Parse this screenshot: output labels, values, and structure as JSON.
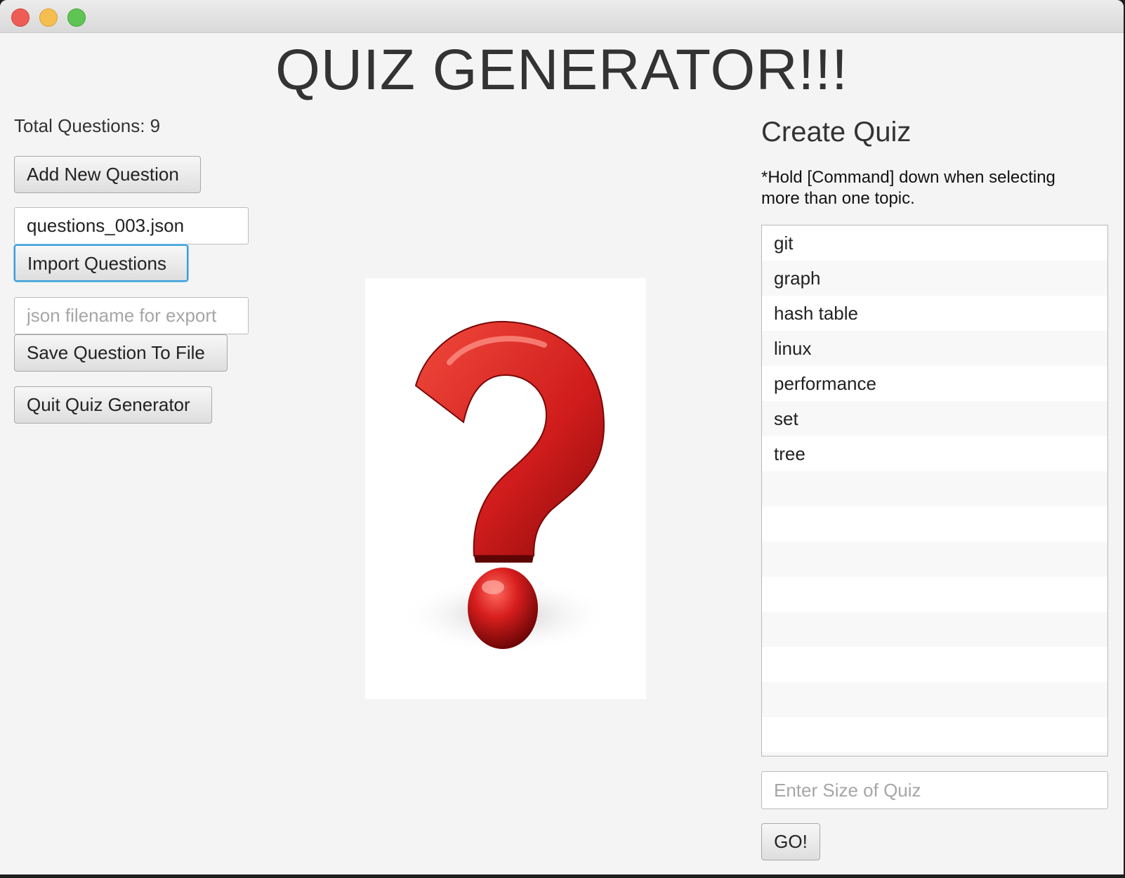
{
  "window": {
    "title": ""
  },
  "header": {
    "title": "QUIZ GENERATOR!!!"
  },
  "left_panel": {
    "total_questions": "Total Questions: 9",
    "add_button": "Add New Question",
    "import_field_value": "questions_003.json",
    "import_button": "Import Questions",
    "export_field_placeholder": "json filename for export",
    "save_button": "Save Question To File",
    "quit_button": "Quit Quiz Generator"
  },
  "center": {
    "image_icon": "question-mark-icon",
    "image_color": "#d42020"
  },
  "create_quiz": {
    "title": "Create Quiz",
    "hint": "*Hold [Command] down when selecting\n more than one topic.",
    "topics": [
      "git",
      "graph",
      "hash table",
      "linux",
      "performance",
      "set",
      "tree"
    ],
    "size_placeholder": "Enter Size of Quiz",
    "go_button": "GO!"
  }
}
